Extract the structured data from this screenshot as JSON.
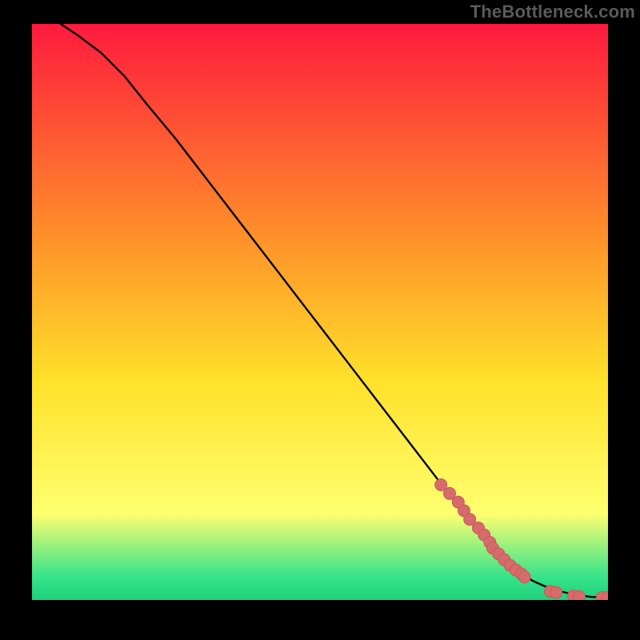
{
  "attribution": "TheBottleneck.com",
  "colors": {
    "frame": "#000000",
    "attribution_text": "#5a5a5a",
    "curve": "#000000",
    "marker_fill": "#d76a6a",
    "marker_stroke": "#c85a5a",
    "gradient_top": "#ff1a3e",
    "gradient_mid1": "#ff8a2a",
    "gradient_mid2": "#ffe12a",
    "gradient_mid3": "#ffff70",
    "gradient_lowband": "#35e38a",
    "gradient_bottom": "#1fd17b"
  },
  "chart_data": {
    "type": "line",
    "title": "",
    "xlabel": "",
    "ylabel": "",
    "xlim": [
      0,
      100
    ],
    "ylim": [
      0,
      100
    ],
    "series": [
      {
        "name": "curve",
        "x": [
          5,
          8,
          12,
          16,
          20,
          25,
          30,
          35,
          40,
          45,
          50,
          55,
          60,
          65,
          70,
          75,
          80,
          83,
          85,
          87,
          89,
          91,
          93,
          95,
          97,
          99,
          100
        ],
        "y": [
          100,
          98,
          95,
          91,
          86,
          80,
          73.5,
          67,
          60.5,
          54,
          47.5,
          41,
          34.5,
          28,
          21.5,
          15,
          9,
          6,
          4.5,
          3.3,
          2.4,
          1.7,
          1.2,
          0.8,
          0.55,
          0.45,
          0.45
        ]
      }
    ],
    "markers": {
      "name": "highlighted-points",
      "x": [
        71,
        72.5,
        74,
        75,
        76,
        77.5,
        78.5,
        79.5,
        80,
        81,
        82,
        83,
        84,
        85,
        85.5,
        90,
        91,
        94,
        95,
        99,
        100
      ],
      "y": [
        20,
        18.5,
        17,
        15.5,
        14,
        12.5,
        11.3,
        10,
        9,
        8,
        7,
        6,
        5.2,
        4.5,
        4,
        1.5,
        1.3,
        0.7,
        0.6,
        0.45,
        0.45
      ]
    }
  }
}
